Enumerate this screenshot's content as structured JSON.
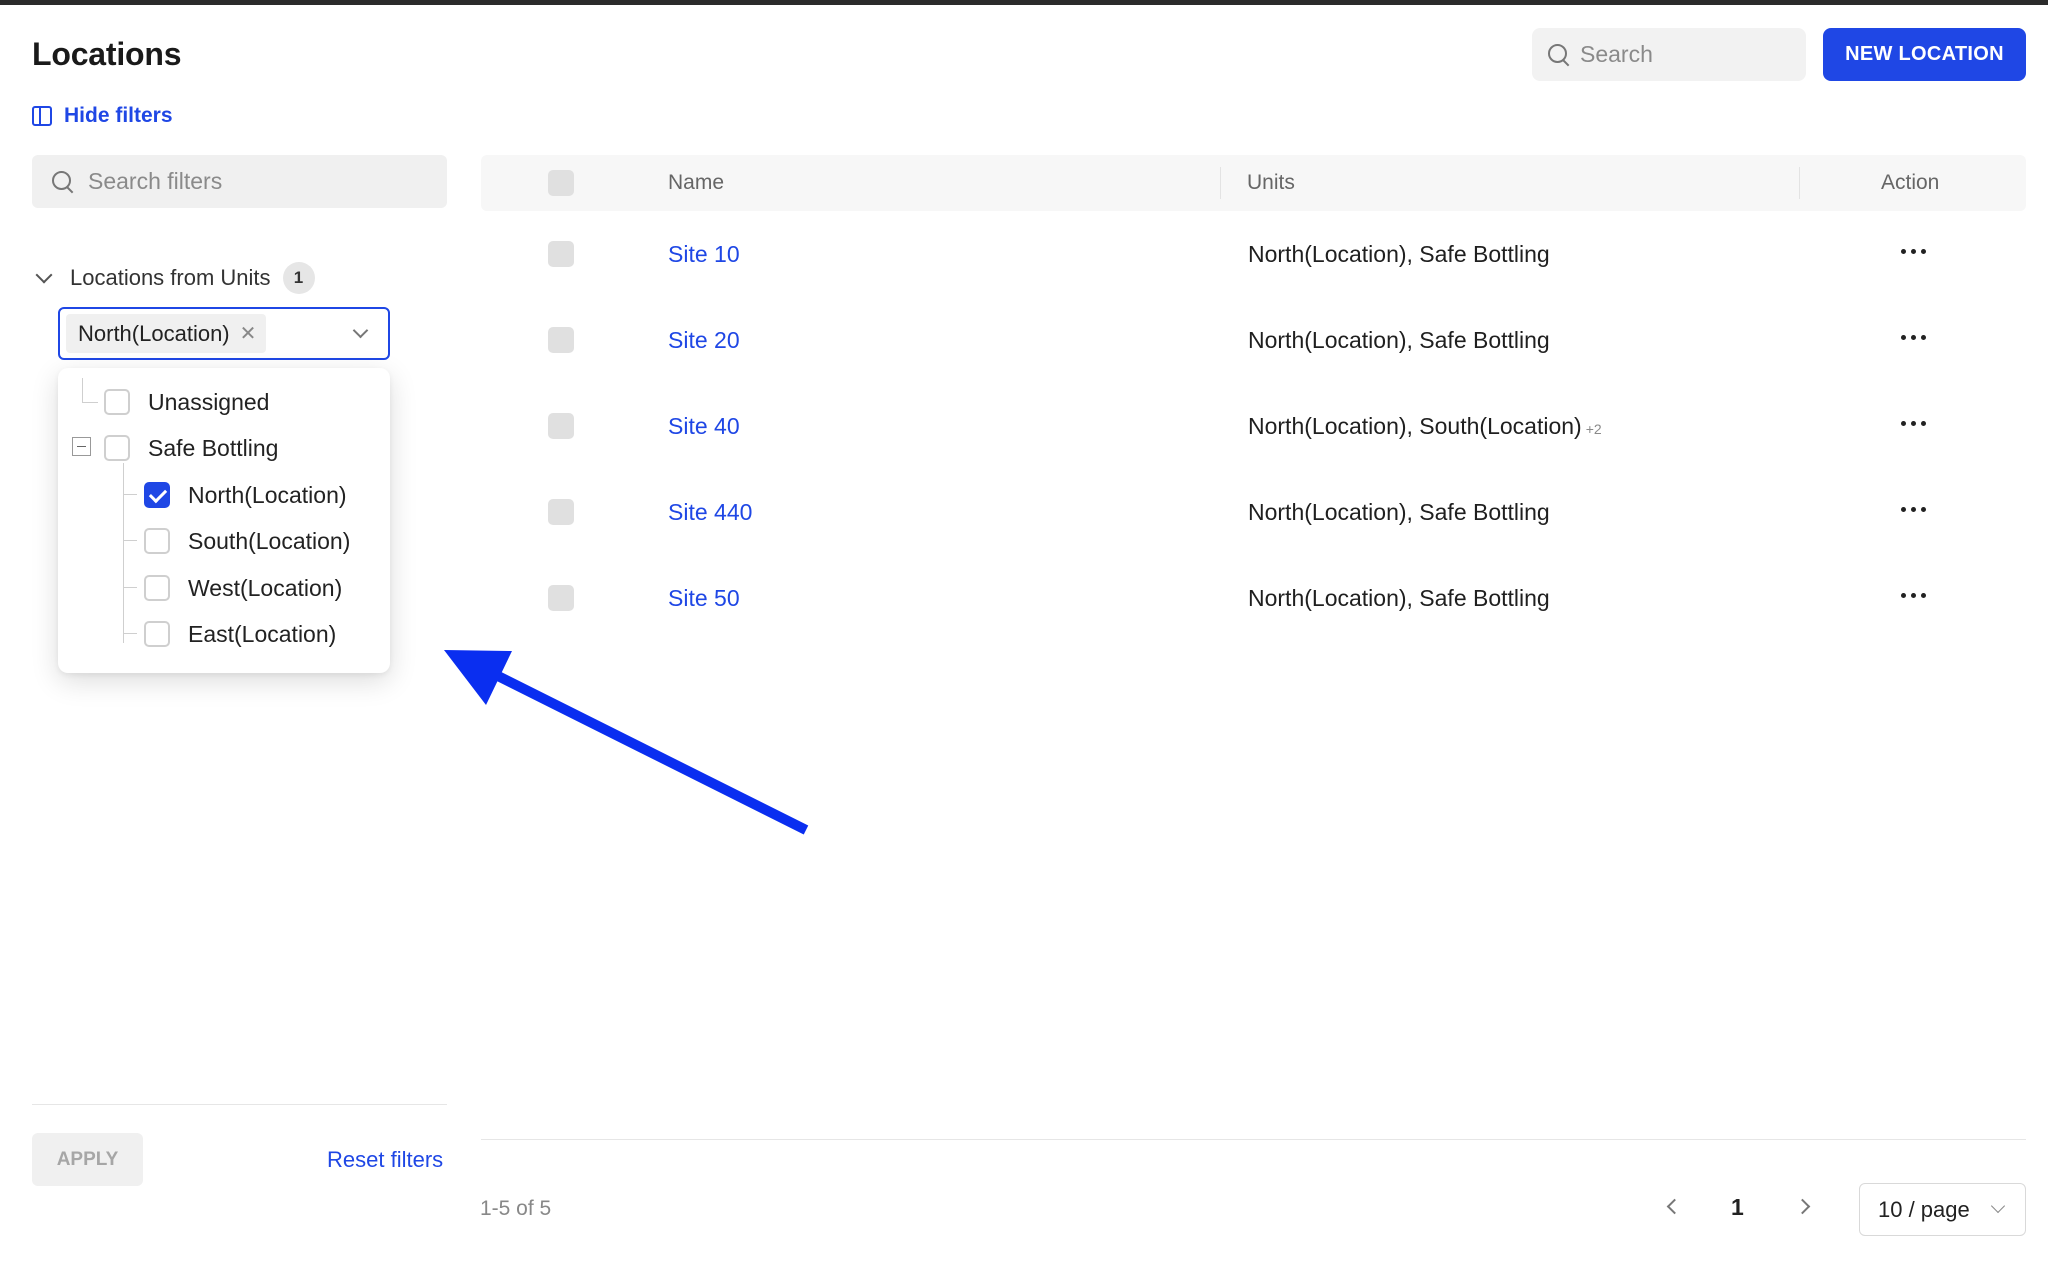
{
  "header": {
    "title": "Locations",
    "search_placeholder": "Search",
    "new_button": "NEW LOCATION"
  },
  "filters": {
    "hide_label": "Hide filters",
    "search_placeholder": "Search filters",
    "group_label": "Locations from Units",
    "group_count": "1",
    "selected_tag": "North(Location)",
    "tree": {
      "unassigned": "Unassigned",
      "parent": "Safe Bottling",
      "children": [
        "North(Location)",
        "South(Location)",
        "West(Location)",
        "East(Location)"
      ],
      "checked": "North(Location)"
    },
    "apply_label": "APPLY",
    "reset_label": "Reset filters"
  },
  "table": {
    "headers": {
      "name": "Name",
      "units": "Units",
      "action": "Action"
    },
    "rows": [
      {
        "name": "Site 10",
        "units": "North(Location), Safe Bottling",
        "more": ""
      },
      {
        "name": "Site 20",
        "units": "North(Location), Safe Bottling",
        "more": ""
      },
      {
        "name": "Site 40",
        "units": "North(Location), South(Location)",
        "more": "+2"
      },
      {
        "name": "Site 440",
        "units": "North(Location), Safe Bottling",
        "more": ""
      },
      {
        "name": "Site 50",
        "units": "North(Location), Safe Bottling",
        "more": ""
      }
    ]
  },
  "pagination": {
    "info": "1-5 of 5",
    "current_page": "1",
    "page_size": "10 / page"
  },
  "colors": {
    "accent": "#1f47e5",
    "annotation_arrow": "#0a2ef0"
  },
  "icons": [
    "search-icon",
    "sidebar-panel-icon",
    "chevron-down-icon",
    "close-icon",
    "more-horizontal-icon",
    "chevron-left-icon",
    "chevron-right-icon",
    "collapse-minus-icon"
  ]
}
